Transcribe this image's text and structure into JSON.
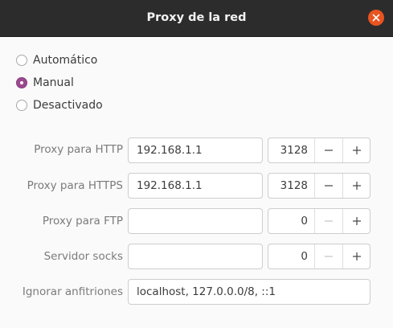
{
  "window": {
    "title": "Proxy de la red",
    "close_icon": "close-icon",
    "accent": "#e95420"
  },
  "mode": {
    "options": [
      "Automático",
      "Manual",
      "Desactivado"
    ],
    "selected": "Manual",
    "radio_color": "#9b4a8f"
  },
  "http": {
    "label": "Proxy para HTTP",
    "host": "192.168.1.1",
    "port": "3128"
  },
  "https": {
    "label": "Proxy para HTTPS",
    "host": "192.168.1.1",
    "port": "3128"
  },
  "ftp": {
    "label": "Proxy para FTP",
    "host": "",
    "port": "0"
  },
  "socks": {
    "label": "Servidor socks",
    "host": "",
    "port": "0"
  },
  "ignore": {
    "label": "Ignorar anfitriones",
    "value": "localhost, 127.0.0.0/8, ::1"
  },
  "icons": {
    "decrement": "minus-icon",
    "increment": "plus-icon"
  }
}
